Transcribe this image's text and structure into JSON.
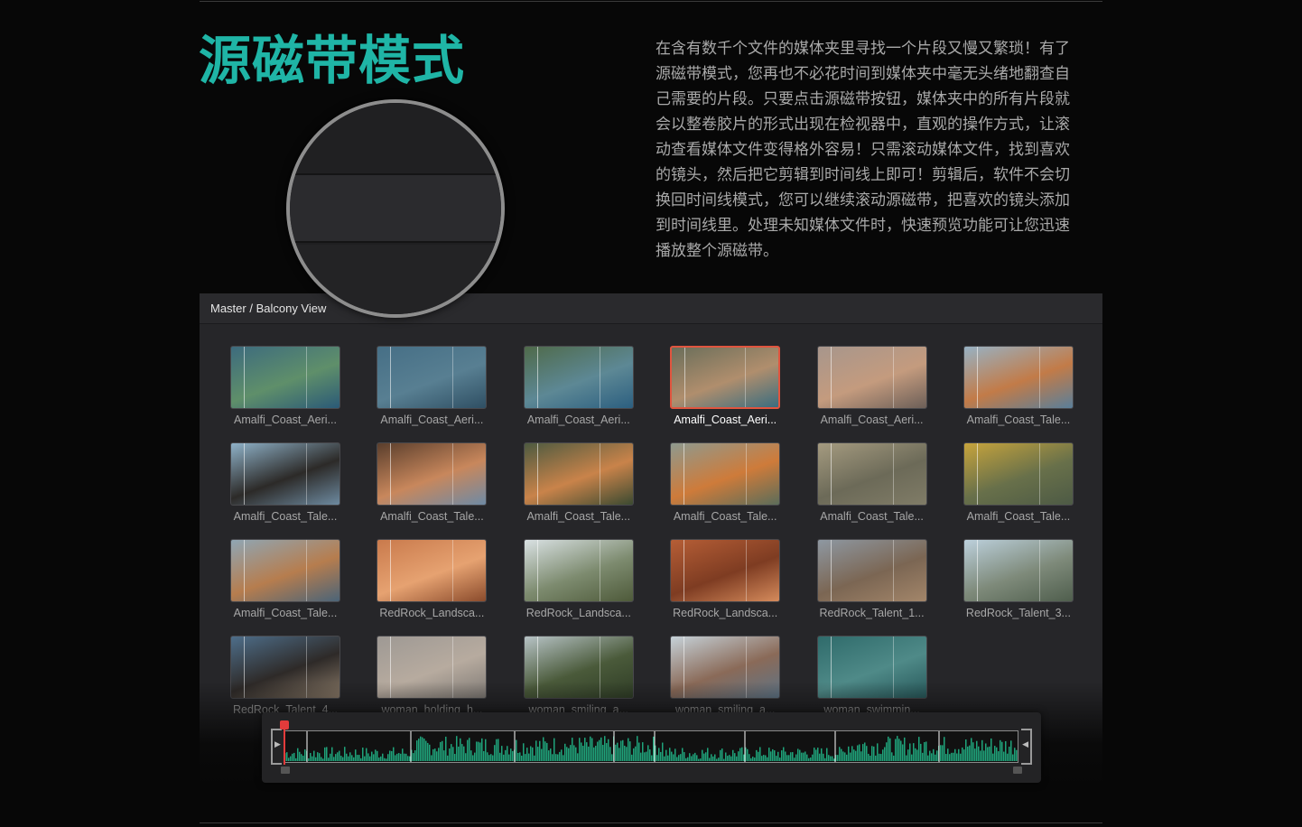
{
  "page": {
    "title": "源磁带模式",
    "description": "在含有数千个文件的媒体夹里寻找一个片段又慢又繁琐！有了源磁带模式，您再也不必花时间到媒体夹中毫无头绪地翻查自己需要的片段。只要点击源磁带按钮，媒体夹中的所有片段就会以整卷胶片的形式出现在检视器中，直观的操作方式，让滚动查看媒体文件变得格外容易！只需滚动媒体文件，找到喜欢的镜头，然后把它剪辑到时间线上即可！剪辑后，软件不会切换回时间线模式，您可以继续滚动源磁带，把喜欢的镜头添加到时间线里。处理未知媒体文件时，快速预览功能可让您迅速播放整个源磁带。"
  },
  "toolbar_icons": [
    "image-view-icon",
    "source-tape-icon",
    "strip-view-icon"
  ],
  "browser": {
    "breadcrumb": "Master / Balcony View",
    "clips": [
      {
        "label": "Amalfi_Coast_Aeri...",
        "colors": [
          "#3d6b7e",
          "#5f8f6a",
          "#2b5a77"
        ]
      },
      {
        "label": "Amalfi_Coast_Aeri...",
        "colors": [
          "#466f86",
          "#587f92",
          "#2f4f63"
        ]
      },
      {
        "label": "Amalfi_Coast_Aeri...",
        "colors": [
          "#4f6a4a",
          "#5d8895",
          "#2c5f80"
        ]
      },
      {
        "label": "Amalfi_Coast_Aeri...",
        "colors": [
          "#6a6e5a",
          "#b08e6d",
          "#3a6d7f"
        ],
        "selected": true
      },
      {
        "label": "Amalfi_Coast_Aeri...",
        "colors": [
          "#a7968c",
          "#c49b7e",
          "#6c5f58"
        ]
      },
      {
        "label": "Amalfi_Coast_Tale...",
        "colors": [
          "#97b2c4",
          "#c27b48",
          "#5a7f9a"
        ]
      },
      {
        "label": "Amalfi_Coast_Tale...",
        "colors": [
          "#8fb2c9",
          "#2c2a28",
          "#6d8aa0"
        ]
      },
      {
        "label": "Amalfi_Coast_Tale...",
        "colors": [
          "#5a3e2c",
          "#c8875c",
          "#6e8aa5"
        ]
      },
      {
        "label": "Amalfi_Coast_Tale...",
        "colors": [
          "#4d5a40",
          "#c9834a",
          "#3b4a31"
        ]
      },
      {
        "label": "Amalfi_Coast_Tale...",
        "colors": [
          "#8e9a8f",
          "#ce7b3a",
          "#5b6d5a"
        ]
      },
      {
        "label": "Amalfi_Coast_Tale...",
        "colors": [
          "#a59b80",
          "#6c6a58",
          "#807c67"
        ]
      },
      {
        "label": "Amalfi_Coast_Tale...",
        "colors": [
          "#c7a43c",
          "#68704a",
          "#4d5a45"
        ]
      },
      {
        "label": "Amalfi_Coast_Tale...",
        "colors": [
          "#8fa6b4",
          "#b67d4e",
          "#4b6478"
        ]
      },
      {
        "label": "RedRock_Landsca...",
        "colors": [
          "#c97a4c",
          "#e6a271",
          "#8a4b2c"
        ]
      },
      {
        "label": "RedRock_Landsca...",
        "colors": [
          "#d9e1e3",
          "#7d8b6f",
          "#4e5a3a"
        ]
      },
      {
        "label": "RedRock_Landsca...",
        "colors": [
          "#b65e36",
          "#7e3c22",
          "#d58b5c"
        ]
      },
      {
        "label": "RedRock_Talent_1...",
        "colors": [
          "#8e98a2",
          "#7b6653",
          "#a3866a"
        ]
      },
      {
        "label": "RedRock_Talent_3...",
        "colors": [
          "#bcd0dc",
          "#7e8a7a",
          "#4f5e4d"
        ]
      },
      {
        "label": "RedRock_Talent_4...",
        "colors": [
          "#4e6e8a",
          "#2e2a28",
          "#8a7a68"
        ]
      },
      {
        "label": "woman_holding_h...",
        "colors": [
          "#9e9994",
          "#b7ab9f",
          "#7f7a75"
        ]
      },
      {
        "label": "woman_smiling_a...",
        "colors": [
          "#b7c3c6",
          "#4a5a3a",
          "#2f3d26"
        ]
      },
      {
        "label": "woman_smiling_a...",
        "colors": [
          "#c6d2d9",
          "#8a6a58",
          "#5e7486"
        ]
      },
      {
        "label": "woman_swimmin...",
        "colors": [
          "#2f6b6b",
          "#4f8a88",
          "#27585a"
        ]
      }
    ]
  },
  "scrubber": {
    "accent": "#1fa37a",
    "playhead_color": "#e33b3b"
  }
}
